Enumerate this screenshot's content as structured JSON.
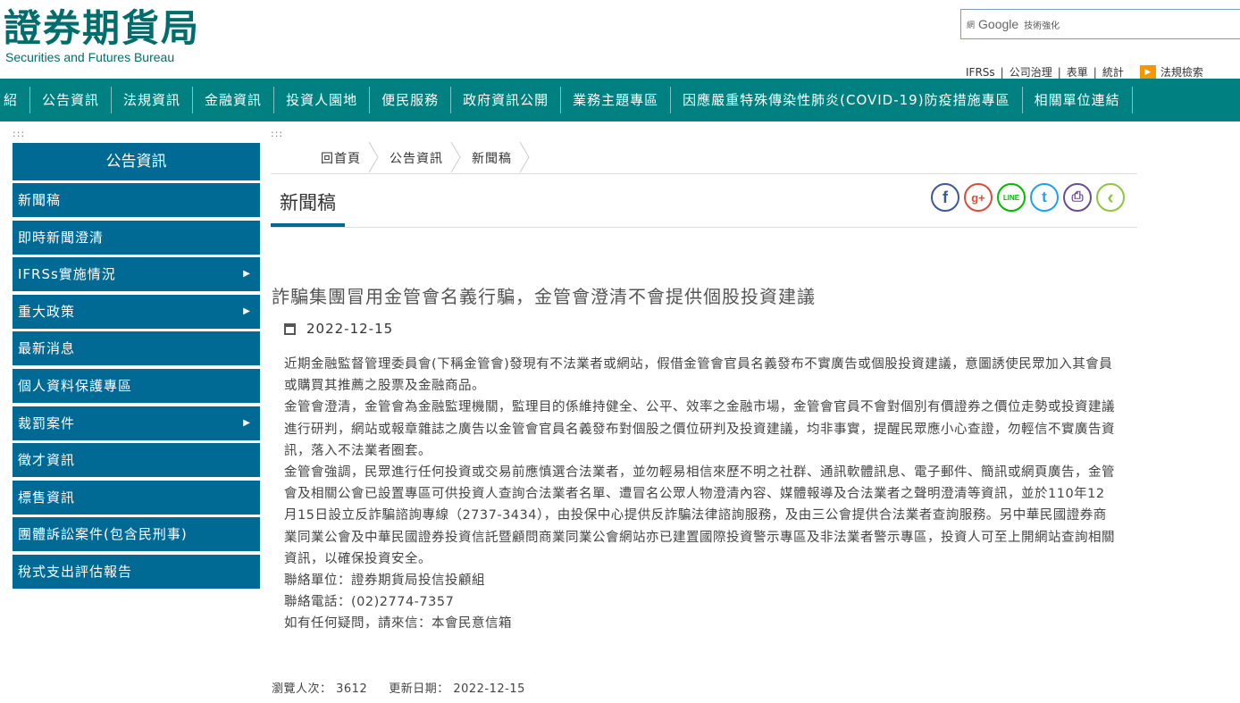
{
  "header": {
    "logo_zh": "證券期貨局",
    "logo_en": "Securities and Futures Bureau",
    "search": {
      "prefix": "網",
      "brand": "Google",
      "suffix": "技術強化"
    },
    "toplinks": [
      "IFRSs",
      "公司治理",
      "表單",
      "統計"
    ],
    "law_search": "法規檢索"
  },
  "nav": [
    "紹",
    "公告資訊",
    "法規資訊",
    "金融資訊",
    "投資人園地",
    "便民服務",
    "政府資訊公開",
    "業務主題專區",
    "因應嚴重特殊傳染性肺炎(COVID-19)防疫措施專區",
    "相關單位連結"
  ],
  "sidebar": {
    "dots": ":::",
    "heading": "公告資訊",
    "items": [
      {
        "label": "新聞稿",
        "has_sub": false
      },
      {
        "label": "即時新聞澄清",
        "has_sub": false
      },
      {
        "label": "IFRSs實施情況",
        "has_sub": true
      },
      {
        "label": "重大政策",
        "has_sub": true
      },
      {
        "label": "最新消息",
        "has_sub": false
      },
      {
        "label": "個人資料保護專區",
        "has_sub": false
      },
      {
        "label": "裁罰案件",
        "has_sub": true
      },
      {
        "label": "徵才資訊",
        "has_sub": false
      },
      {
        "label": "標售資訊",
        "has_sub": false
      },
      {
        "label": "團體訴訟案件(包含民刑事)",
        "has_sub": false
      },
      {
        "label": "稅式支出評估報告",
        "has_sub": false
      }
    ]
  },
  "main": {
    "dots": ":::",
    "breadcrumb": [
      "回首頁",
      "公告資訊",
      "新聞稿"
    ],
    "page_title": "新聞稿",
    "share": [
      {
        "name": "facebook-icon",
        "glyph": "f",
        "color": "#3b5998"
      },
      {
        "name": "google-plus-icon",
        "glyph": "g+",
        "color": "#dd4b39"
      },
      {
        "name": "line-icon",
        "glyph": "LINE",
        "color": "#00b900"
      },
      {
        "name": "twitter-icon",
        "glyph": "t",
        "color": "#1da1f2"
      },
      {
        "name": "print-icon",
        "glyph": "⎙",
        "color": "#6a4c93"
      },
      {
        "name": "back-icon",
        "glyph": "‹",
        "color": "#8dc63f"
      }
    ]
  },
  "article": {
    "title": "詐騙集團冒用金管會名義行騙，金管會澄清不會提供個股投資建議",
    "date": "2022-12-15",
    "paragraphs": [
      "近期金融監督管理委員會(下稱金管會)發現有不法業者或網站，假借金管會官員名義發布不實廣告或個股投資建議，意圖誘使民眾加入其會員或購買其推薦之股票及金融商品。",
      "金管會澄清，金管會為金融監理機關，監理目的係維持健全、公平、效率之金融市場，金管會官員不會對個別有價證券之價位走勢或投資建議進行研判，網站或報章雜誌之廣告以金管會官員名義發布對個股之價位研判及投資建議，均非事實，提醒民眾應小心查證，勿輕信不實廣告資訊，落入不法業者圈套。",
      "金管會強調，民眾進行任何投資或交易前應慎選合法業者，並勿輕易相信來歷不明之社群、通訊軟體訊息、電子郵件、簡訊或網頁廣告，金管會及相關公會已設置專區可供投資人查詢合法業者名單、遭冒名公眾人物澄清內容、媒體報導及合法業者之聲明澄清等資訊，並於110年12月15日設立反詐騙諮詢專線（2737-3434），由投保中心提供反詐騙法律諮詢服務，及由三公會提供合法業者查詢服務。另中華民國證券商業同業公會及中華民國證券投資信託暨顧問商業同業公會網站亦已建置國際投資警示專區及非法業者警示專區，投資人可至上開網站查詢相關資訊，以確保投資安全。",
      "聯絡單位：證券期貨局投信投顧組",
      "聯絡電話：(02)2774-7357",
      "如有任何疑問，請來信：本會民意信箱"
    ]
  },
  "footer": {
    "views": "瀏覽人次： 3612",
    "updated": "更新日期： 2022-12-15"
  }
}
